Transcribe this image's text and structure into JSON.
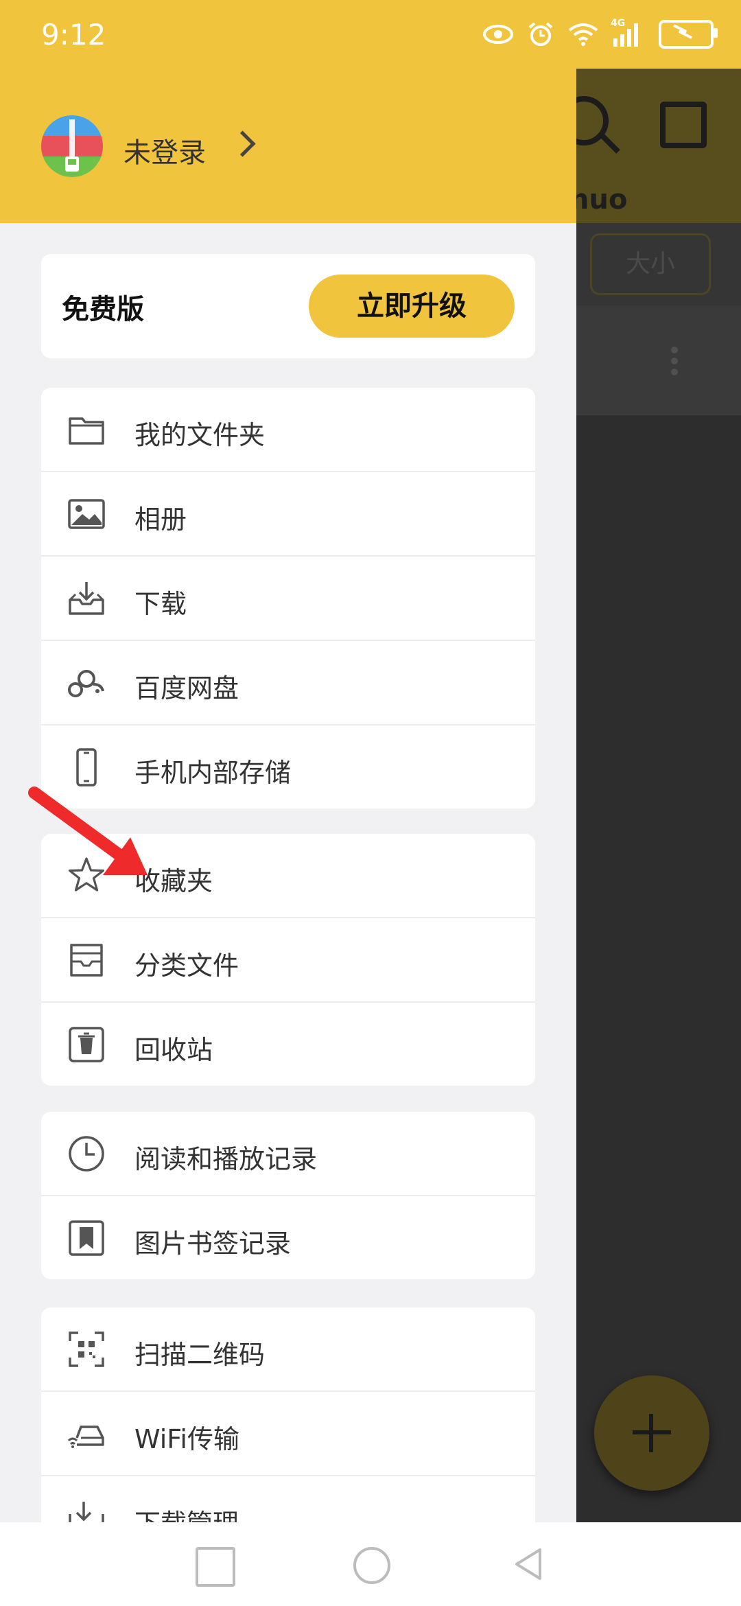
{
  "status_bar": {
    "time": "9:12",
    "icons": [
      "eye-icon",
      "alarm-icon",
      "wifi-icon",
      "4g-signal-icon",
      "battery-icon"
    ],
    "network": "4G"
  },
  "underlying": {
    "title_fragment": "nuo",
    "chip_label": "大小",
    "fab_label": "+"
  },
  "drawer": {
    "account": {
      "label": "未登录"
    },
    "plan": {
      "label": "免费版",
      "upgrade_button": "立即升级"
    },
    "groups": [
      [
        {
          "label": "我的文件夹",
          "icon": "folder-icon"
        },
        {
          "label": "相册",
          "icon": "image-icon"
        },
        {
          "label": "下载",
          "icon": "download-tray-icon"
        },
        {
          "label": "百度网盘",
          "icon": "cloud-icon"
        },
        {
          "label": "手机内部存储",
          "icon": "phone-icon"
        }
      ],
      [
        {
          "label": "收藏夹",
          "icon": "star-icon"
        },
        {
          "label": "分类文件",
          "icon": "archive-box-icon"
        },
        {
          "label": "回收站",
          "icon": "trash-icon"
        }
      ],
      [
        {
          "label": "阅读和播放记录",
          "icon": "clock-icon"
        },
        {
          "label": "图片书签记录",
          "icon": "bookmark-icon",
          "badge": true
        }
      ],
      [
        {
          "label": "扫描二维码",
          "icon": "qr-scan-icon"
        },
        {
          "label": "WiFi传输",
          "icon": "wifi-transfer-icon"
        },
        {
          "label": "下载管理",
          "icon": "download-manage-icon",
          "badge": true
        }
      ]
    ]
  },
  "colors": {
    "accent": "#f0c43c",
    "badge": "#e53935",
    "annotation_arrow": "#ee2a2a"
  }
}
